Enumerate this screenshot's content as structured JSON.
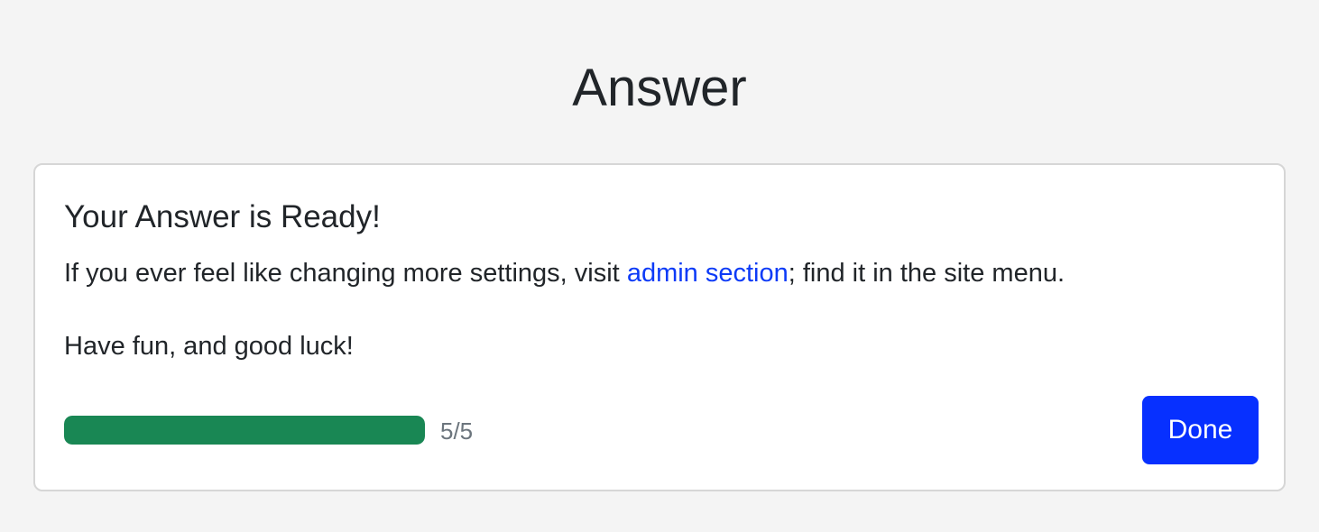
{
  "page": {
    "title": "Answer"
  },
  "card": {
    "title": "Your Answer is Ready!",
    "message_before_link": "If you ever feel like changing more settings, visit ",
    "link_text": "admin section",
    "message_after_link": "; find it in the site menu.",
    "closing": "Have fun, and good luck!",
    "progress": {
      "current": 5,
      "total": 5,
      "fraction": 1.0,
      "label": "5/5"
    },
    "done_label": "Done"
  },
  "colors": {
    "background": "#f4f4f4",
    "card": "#ffffff",
    "text": "#212529",
    "link": "#0d3bf7",
    "progress_fill": "#198754",
    "progress_label": "#6c757d",
    "button": "#0730ff"
  }
}
